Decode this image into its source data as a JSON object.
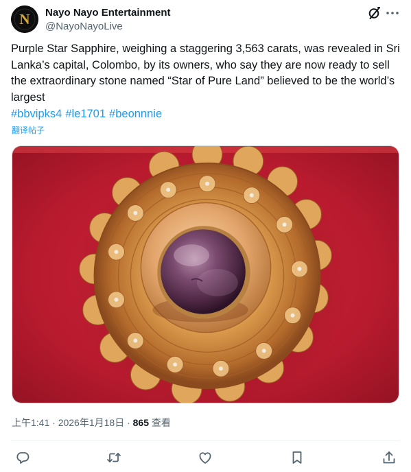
{
  "author": {
    "display_name": "Nayo Nayo Entertainment",
    "handle": "@NayoNayoLive",
    "avatar_letter": "N"
  },
  "tweet": {
    "text": "Purple Star Sapphire, weighing a staggering 3,563 carats, was revealed in Sri Lanka’s capital, Colombo, by its owners, who say they are now ready to sell the extraordinary stone named “Star of Pure Land” believed to be the world’s largest",
    "hashtags": [
      "#bbvipks4",
      "#le1701",
      "#beonnnie"
    ],
    "translate_label": "翻译帖子"
  },
  "meta": {
    "timestamp": "上午1:41 · 2026年1月18日 · ",
    "views_count": "865",
    "views_label": " 查看"
  },
  "icons": {
    "header": [
      "grok-icon",
      "more-icon"
    ],
    "actions": [
      "reply-icon",
      "retweet-icon",
      "like-icon",
      "bookmark-icon",
      "share-icon"
    ]
  },
  "colors": {
    "accent": "#1d9bf0",
    "secondary_text": "#536471",
    "primary_text": "#0f1419",
    "divider": "#eff3f4"
  }
}
